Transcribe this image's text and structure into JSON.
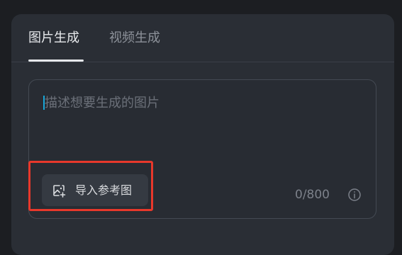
{
  "tabs": [
    {
      "label": "图片生成",
      "active": true
    },
    {
      "label": "视频生成",
      "active": false
    }
  ],
  "prompt": {
    "placeholder": "描述想要生成的图片",
    "value": ""
  },
  "import_button": {
    "label": "导入参考图",
    "icon": "image-add-icon"
  },
  "counter": {
    "text": "0/800",
    "current": 0,
    "max": 800
  },
  "info_icon": "info-icon",
  "colors": {
    "panel_bg": "#2a2e35",
    "page_bg": "#1c1e22",
    "caret": "#19a7d8",
    "highlight": "#e8382b"
  }
}
